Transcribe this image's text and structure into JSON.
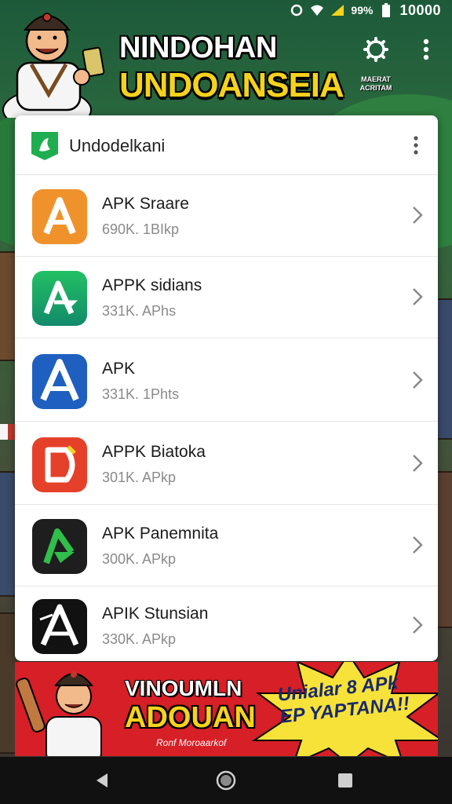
{
  "status_bar": {
    "battery_text": "99%",
    "time": "10000"
  },
  "header": {
    "title_line1": "NINDOHAN",
    "title_line2": "UNDOANSEIA",
    "caption": "MAERAT ACRITAM"
  },
  "card": {
    "title": "Undodelkani",
    "apps": [
      {
        "name": "APK Sraare",
        "meta": "690K. 1BIkp",
        "icon": "apk-orange-a-icon",
        "color": "#f0922b"
      },
      {
        "name": "APPK sidians",
        "meta": "331K. APhs",
        "icon": "apk-green-a-icon",
        "color": "#1fb25a"
      },
      {
        "name": "APK",
        "meta": "331K. 1Phts",
        "icon": "apk-blue-a-icon",
        "color": "#1f5fbf"
      },
      {
        "name": "APPK Biatoka",
        "meta": "301K. APkp",
        "icon": "apk-red-d-icon",
        "color": "#e5402a"
      },
      {
        "name": "APK Panemnita",
        "meta": "300K. APkp",
        "icon": "apk-black-green-a-icon",
        "color": "#1e1e1e"
      },
      {
        "name": "APIK Stunsian",
        "meta": "330K. APkp",
        "icon": "apk-black-a-icon",
        "color": "#111111"
      }
    ]
  },
  "banner": {
    "title_line1": "VINOUMLN",
    "title_line2": "ADOUAN",
    "subtitle": "Ronf Moroaarkof",
    "star_line1": "Unialar 8 APk",
    "star_line2": "EP YAPTANA!!"
  },
  "colors": {
    "banner_red": "#d61f26",
    "title_yellow": "#f5d21c",
    "nav_black": "#111111"
  }
}
